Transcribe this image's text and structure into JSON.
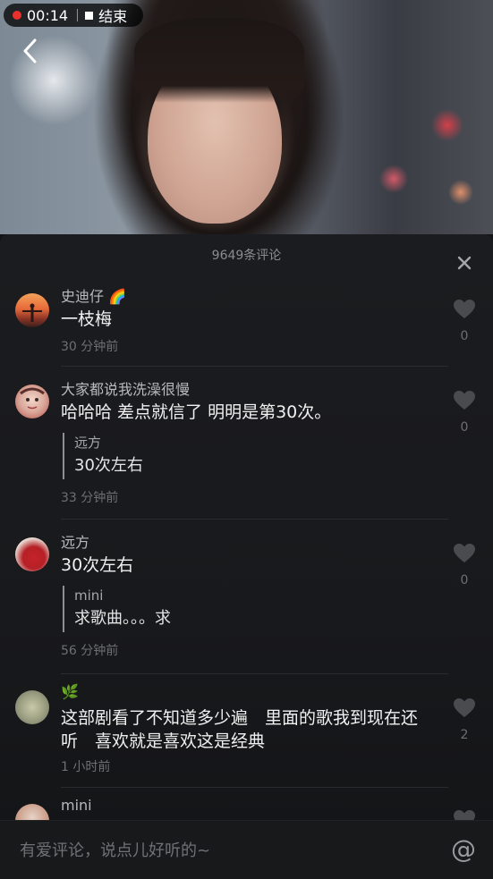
{
  "status": {
    "rec_time": "00:14",
    "end_label": "结束"
  },
  "sheet": {
    "title": "9649条评论"
  },
  "comments": [
    {
      "user": "史迪仔",
      "emoji": "🌈",
      "text": "一枝梅",
      "time": "30 分钟前",
      "likes": "0"
    },
    {
      "user": "大家都说我洗澡很慢",
      "text": "哈哈哈 差点就信了 明明是第30次。",
      "reply": {
        "user": "远方",
        "text": "30次左右"
      },
      "time": "33 分钟前",
      "likes": "0"
    },
    {
      "user": "远方",
      "text": "30次左右",
      "reply": {
        "user": "mini",
        "text": "求歌曲。。。求"
      },
      "time": "56 分钟前",
      "likes": "0"
    },
    {
      "user": "",
      "emoji": "🌿",
      "text": "这部剧看了不知道多少遍　里面的歌我到现在还听　喜欢就是喜欢这是经典",
      "time": "1 小时前",
      "likes": "2"
    },
    {
      "user": "mini"
    }
  ],
  "input": {
    "placeholder": "有爱评论，说点儿好听的~",
    "at_symbol": "@"
  },
  "colors": {
    "record_red": "#e8302c",
    "sheet_bg": "#1b1c1f"
  }
}
